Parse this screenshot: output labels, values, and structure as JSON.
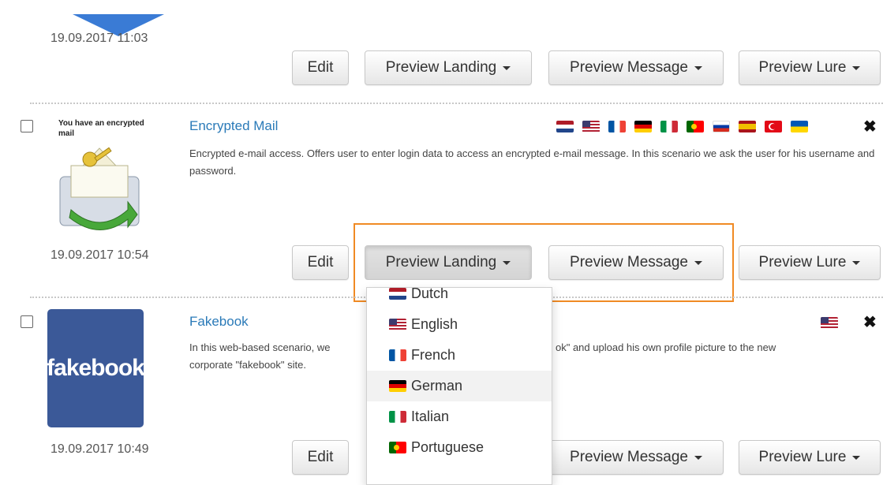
{
  "rows": [
    {
      "date": "19.09.2017 11:03",
      "buttons": {
        "edit": "Edit",
        "preview_landing": "Preview Landing",
        "preview_message": "Preview Message",
        "preview_lure": "Preview Lure"
      }
    },
    {
      "title": "Encrypted Mail",
      "thumbnail_caption": "You have an encrypted mail",
      "description": "Encrypted e-mail access. Offers user to enter login data to access an encrypted e-mail message. In this scenario we ask the user for his username and password.",
      "date": "19.09.2017 10:54",
      "flags": [
        "netherlands-flag-icon",
        "usa-flag-icon",
        "france-flag-icon",
        "germany-flag-icon",
        "italy-flag-icon",
        "portugal-flag-icon",
        "russia-flag-icon",
        "spain-flag-icon",
        "turkey-flag-icon",
        "ukraine-flag-icon"
      ],
      "buttons": {
        "edit": "Edit",
        "preview_landing": "Preview Landing",
        "preview_message": "Preview Message",
        "preview_lure": "Preview Lure"
      }
    },
    {
      "title": "Fakebook",
      "thumbnail_text": "fakebook",
      "description_left": "In this web-based scenario, we",
      "description_right": "ok\" and upload his own profile picture to the new",
      "description_line2": "corporate \"fakebook\" site.",
      "date": "19.09.2017 10:49",
      "flags": [
        "usa-flag-icon"
      ],
      "buttons": {
        "edit": "Edit",
        "preview_message": "Preview Message",
        "preview_lure": "Preview Lure"
      }
    }
  ],
  "dropdown": {
    "items": [
      {
        "label": "Dutch",
        "flag": "netherlands-flag-icon"
      },
      {
        "label": "English",
        "flag": "usa-flag-icon"
      },
      {
        "label": "French",
        "flag": "france-flag-icon"
      },
      {
        "label": "German",
        "flag": "germany-flag-icon",
        "hovered": true
      },
      {
        "label": "Italian",
        "flag": "italy-flag-icon"
      },
      {
        "label": "Portuguese",
        "flag": "portugal-flag-icon"
      }
    ]
  },
  "close_glyph": "✖",
  "colors": {
    "link": "#2a7ab8",
    "highlight": "#f08a24",
    "fakebook": "#3b5998",
    "arrow": "#3a7bd5"
  }
}
